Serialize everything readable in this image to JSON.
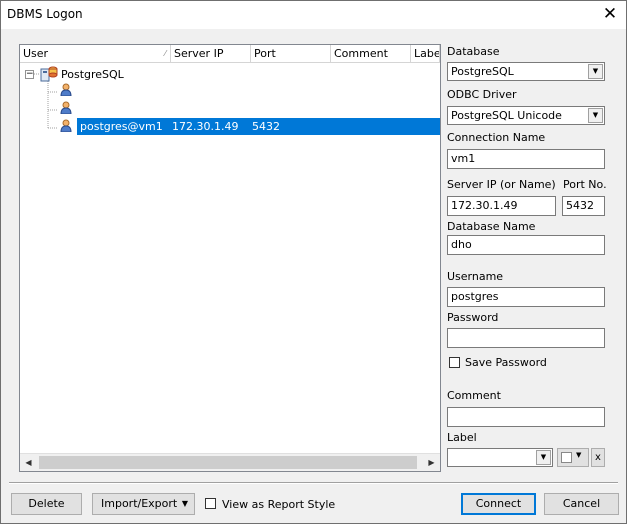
{
  "window": {
    "title": "DBMS Logon"
  },
  "tree": {
    "columns": [
      "User",
      "Server IP",
      "Port",
      "Comment",
      "Label"
    ],
    "root": "PostgreSQL",
    "rows": [
      {
        "user": "",
        "ip": "",
        "port": ""
      },
      {
        "user": "",
        "ip": "",
        "port": ""
      },
      {
        "user": "postgres@vm1",
        "ip": "172.30.1.49",
        "port": "5432"
      }
    ]
  },
  "form": {
    "database_label": "Database",
    "database_value": "PostgreSQL",
    "odbc_label": "ODBC Driver",
    "odbc_value": "PostgreSQL Unicode",
    "conn_name_label": "Connection Name",
    "conn_name_value": "vm1",
    "server_ip_label": "Server IP (or Name)",
    "server_ip_value": "172.30.1.49",
    "port_label": "Port No.",
    "port_value": "5432",
    "db_name_label": "Database Name",
    "db_name_value": "dho",
    "username_label": "Username",
    "username_value": "postgres",
    "password_label": "Password",
    "password_value": "",
    "save_password_label": "Save Password",
    "comment_label": "Comment",
    "comment_value": "",
    "label_label": "Label",
    "label_value": "",
    "label_clear": "x"
  },
  "footer": {
    "delete": "Delete",
    "import_export": "Import/Export",
    "view_report": "View as Report Style",
    "connect": "Connect",
    "cancel": "Cancel"
  }
}
